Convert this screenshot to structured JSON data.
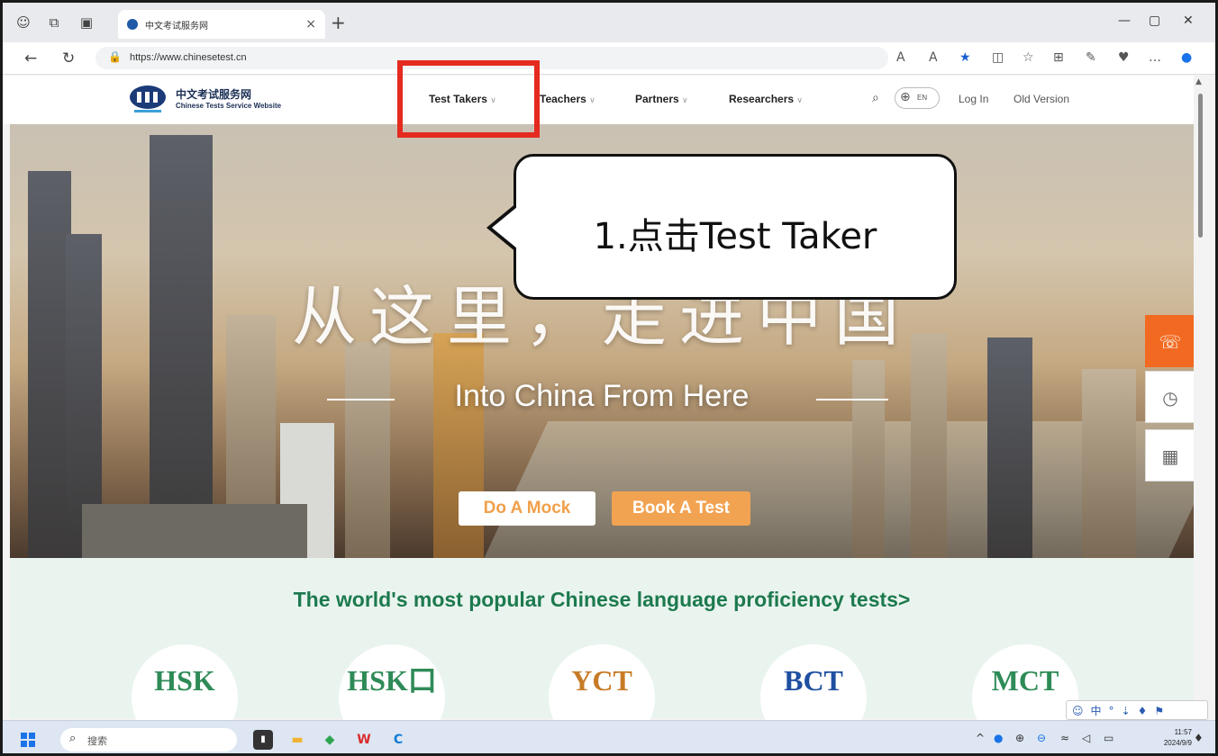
{
  "browser": {
    "tab_title": "中文考试服务网",
    "url": "https://www.chinesetest.cn"
  },
  "site": {
    "logo_cn": "中文考试服务网",
    "logo_en": "Chinese Tests Service Website",
    "nav": [
      {
        "label": "Test Takers"
      },
      {
        "label": "Teachers"
      },
      {
        "label": "Partners"
      },
      {
        "label": "Researchers"
      }
    ],
    "lang": "EN",
    "login": "Log In",
    "old_version": "Old Version"
  },
  "hero": {
    "title_cn": "从这里，走进中国",
    "title_en": "Into China From Here",
    "mock_button": "Do A Mock",
    "book_button": "Book A Test"
  },
  "annotation": {
    "text": "1.点击Test Taker",
    "highlight_color": "#e52a1f"
  },
  "popular": {
    "title": "The world's most popular Chinese language proficiency tests>",
    "tests": [
      {
        "name": "HSK",
        "color": "#2e8b57"
      },
      {
        "name": "HSK口",
        "color": "#2e8b57"
      },
      {
        "name": "YCT",
        "color": "#c77b26"
      },
      {
        "name": "BCT",
        "color": "#1f4fa0"
      },
      {
        "name": "MCT",
        "color": "#2e8b57"
      }
    ]
  },
  "taskbar": {
    "search_placeholder": "搜索",
    "time": "11:57",
    "date": "2024/9/9"
  },
  "colors": {
    "accent_orange": "#f26a21",
    "book_orange": "#f2a352",
    "green_title": "#1d7a4e"
  }
}
